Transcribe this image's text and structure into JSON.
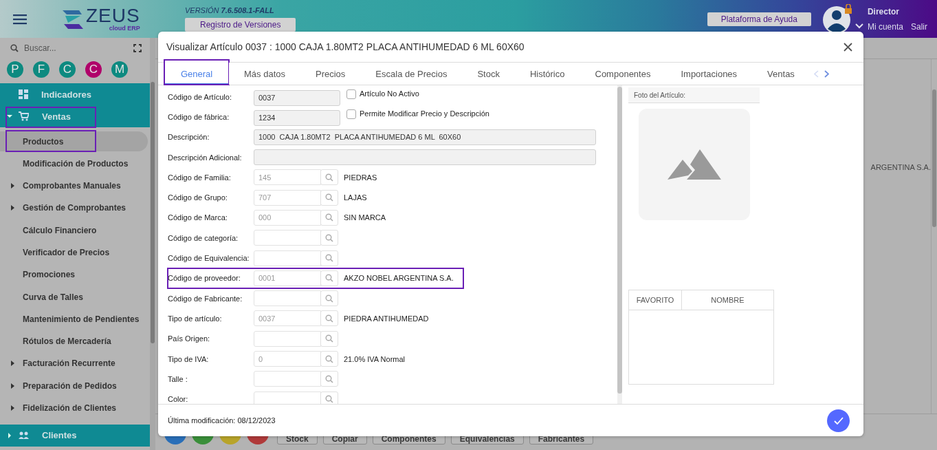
{
  "header": {
    "logo_name": "ZEUS",
    "logo_tagline": "cloud ERP",
    "version_label": "VERSIÓN",
    "version": "7.6.508.1-FALL",
    "versions_button": "Registro de Versiones",
    "help_button": "Plataforma de Ayuda",
    "user_name": "Director",
    "account_link": "Mi cuenta",
    "logout_link": "Salir"
  },
  "sidebar": {
    "search": {
      "placeholder": "Buscar..."
    },
    "shortcuts": [
      {
        "letter": "P",
        "color": "#0d8a80"
      },
      {
        "letter": "F",
        "color": "#0d8a80"
      },
      {
        "letter": "C",
        "color": "#0d8a80"
      },
      {
        "letter": "C",
        "color": "#b0006a"
      },
      {
        "letter": "M",
        "color": "#0d8a80"
      }
    ],
    "menu": [
      {
        "label": "Indicadores",
        "kind": "link"
      },
      {
        "label": "Ventas",
        "kind": "group",
        "expanded": true,
        "highlighted": true,
        "children": [
          {
            "label": "Productos",
            "expandable": false,
            "selected": true,
            "highlighted": true
          },
          {
            "label": "Modificación de Productos",
            "expandable": false,
            "selected": false,
            "highlighted": false
          },
          {
            "label": "Comprobantes Manuales",
            "expandable": true,
            "selected": false,
            "highlighted": false
          },
          {
            "label": "Gestión de Comprobantes",
            "expandable": true,
            "selected": false,
            "highlighted": false
          },
          {
            "label": "Cálculo Financiero",
            "expandable": false,
            "selected": false,
            "highlighted": false
          },
          {
            "label": "Verificador de Precios",
            "expandable": false,
            "selected": false,
            "highlighted": false
          },
          {
            "label": "Promociones",
            "expandable": false,
            "selected": false,
            "highlighted": false
          },
          {
            "label": "Curva de Talles",
            "expandable": false,
            "selected": false,
            "highlighted": false
          },
          {
            "label": "Mantenimiento de Pendientes",
            "expandable": false,
            "selected": false,
            "highlighted": false
          },
          {
            "label": "Rótulos de Mercadería",
            "expandable": false,
            "selected": false,
            "highlighted": false
          },
          {
            "label": "Facturación Recurrente",
            "expandable": true,
            "selected": false,
            "highlighted": false
          },
          {
            "label": "Preparación de Pedidos",
            "expandable": true,
            "selected": false,
            "highlighted": false
          },
          {
            "label": "Fidelización de Clientes",
            "expandable": true,
            "selected": false,
            "highlighted": false
          }
        ]
      },
      {
        "label": "Clientes",
        "kind": "group",
        "expanded": false,
        "highlighted": false
      }
    ]
  },
  "background": {
    "provider_text": "ARGENTINA S.A.",
    "action_circles": [
      {
        "color": "#2a6fb8"
      },
      {
        "color": "#3a8f3a"
      },
      {
        "color": "#b8a42a"
      },
      {
        "color": "#b03a3a"
      }
    ],
    "action_buttons": [
      "Stock",
      "Copiar",
      "Componentes",
      "Equivalencias",
      "Fabricantes"
    ]
  },
  "modal": {
    "title": "Visualizar Artículo 0037 : 1000 CAJA 1.80MT2 PLACA ANTIHUMEDAD 6 ML 60X60",
    "tabs": [
      {
        "label": "General",
        "selected": true,
        "highlighted": true
      },
      {
        "label": "Más datos",
        "selected": false,
        "highlighted": false
      },
      {
        "label": "Precios",
        "selected": false,
        "highlighted": false
      },
      {
        "label": "Escala de Precios",
        "selected": false,
        "highlighted": false
      },
      {
        "label": "Stock",
        "selected": false,
        "highlighted": false
      },
      {
        "label": "Histórico",
        "selected": false,
        "highlighted": false
      },
      {
        "label": "Componentes",
        "selected": false,
        "highlighted": false
      },
      {
        "label": "Importaciones",
        "selected": false,
        "highlighted": false
      },
      {
        "label": "Ventas",
        "selected": false,
        "highlighted": false
      }
    ],
    "fields": [
      {
        "kind": "code",
        "label": "Código de Artículo:",
        "value": "0037",
        "checkbox": {
          "label": "Artículo No Activo",
          "checked": false
        }
      },
      {
        "kind": "code",
        "label": "Código de fábrica:",
        "value": "1234",
        "checkbox": {
          "label": "Permite Modificar Precio y Descripción",
          "checked": false
        }
      },
      {
        "kind": "wide",
        "label": "Descripción:",
        "value": "1000  CAJA 1.80MT2  PLACA ANTIHUMEDAD 6 ML  60X60"
      },
      {
        "kind": "wide",
        "label": "Descripción Adicional:"
      },
      {
        "kind": "lookup",
        "label": "Código de Familia:",
        "value": "145",
        "description": "PIEDRAS",
        "highlighted": false
      },
      {
        "kind": "lookup",
        "label": "Código de Grupo:",
        "value": "707",
        "description": "LAJAS",
        "highlighted": false
      },
      {
        "kind": "lookup",
        "label": "Código de Marca:",
        "value": "000",
        "description": "SIN MARCA",
        "highlighted": false
      },
      {
        "kind": "lookup",
        "label": "Código de categoría:",
        "highlighted": false
      },
      {
        "kind": "lookup",
        "label": "Código de Equivalencia:",
        "highlighted": false
      },
      {
        "kind": "lookup",
        "label": "Código de proveedor:",
        "value": "0001",
        "description": "AKZO NOBEL ARGENTINA S.A.",
        "highlighted": true
      },
      {
        "kind": "lookup",
        "label": "Código de Fabricante:",
        "highlighted": false
      },
      {
        "kind": "lookup",
        "label": "Tipo de artículo:",
        "value": "0037",
        "description": "PIEDRA ANTIHUMEDAD",
        "highlighted": false
      },
      {
        "kind": "lookup",
        "label": "País Origen:",
        "highlighted": false
      },
      {
        "kind": "lookup",
        "label": "Tipo de IVA:",
        "value": "0",
        "description": "21.0% IVA Normal",
        "highlighted": false
      },
      {
        "kind": "lookup",
        "label": "Talle :",
        "highlighted": false
      },
      {
        "kind": "lookup",
        "label": "Color:",
        "highlighted": false
      }
    ],
    "photo_panel": {
      "title": "Foto del Artículo:"
    },
    "favorites_table": {
      "columns": [
        "FAVORITO",
        "NOMBRE"
      ]
    },
    "footer": {
      "last_modified": "Última modificación: 08/12/2023"
    }
  }
}
